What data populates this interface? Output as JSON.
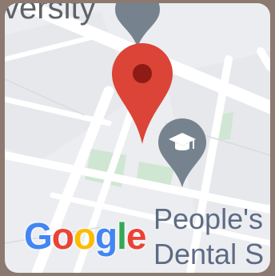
{
  "map": {
    "top_label": "versity",
    "poi_name_line1": "People's",
    "poi_name_line2": "Dental S"
  },
  "attribution": {
    "logo_letters": [
      "G",
      "o",
      "o",
      "g",
      "l",
      "e"
    ]
  },
  "icons": {
    "location_marker": "map-pin-icon",
    "university_marker": "graduation-cap-icon"
  },
  "colors": {
    "marker_red": "#db4437",
    "marker_dark": "#8e1b14",
    "poi_marker": "#76838f",
    "park_green": "#cfe6d3",
    "road": "#ffffff",
    "background": "#ecedf0",
    "poi_text": "#5d6b85"
  }
}
